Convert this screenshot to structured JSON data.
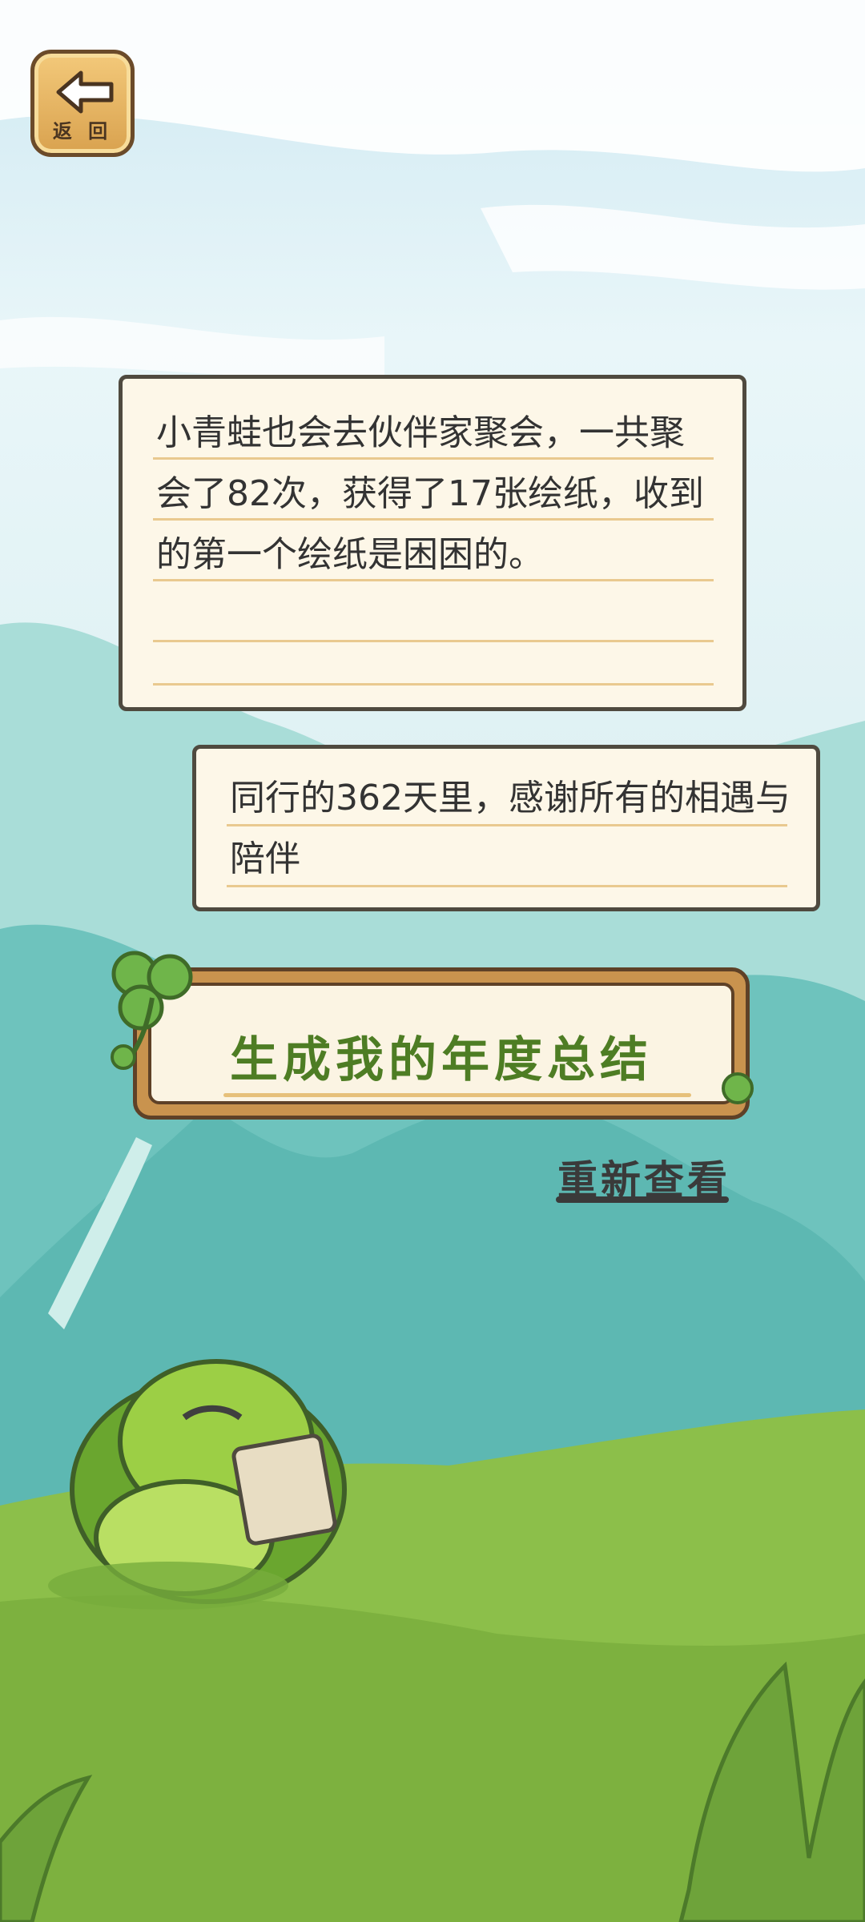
{
  "header": {
    "back_label": "返 回"
  },
  "dialog": {
    "message_1": "小青蛙也会去伙伴家聚会，一共聚会了82次，获得了17张绘纸，收到的第一个绘纸是困困的。",
    "message_2": "同行的362天里，感谢所有的相遇与陪伴"
  },
  "actions": {
    "generate_summary_label": "生成我的年度总结",
    "rewatch_label": "重新查看"
  },
  "colors": {
    "accent_green": "#4e7d24",
    "wood": "#c9934e",
    "paper": "#fdf7e8",
    "ink": "#333333"
  },
  "icons": {
    "back": "back-arrow-icon",
    "clover": "clover-icon"
  }
}
